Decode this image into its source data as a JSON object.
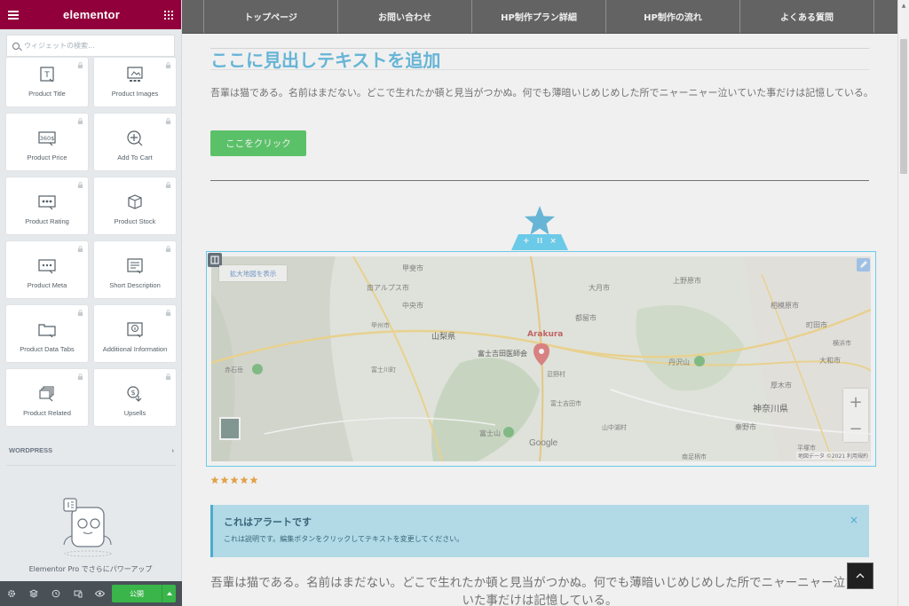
{
  "sidebar": {
    "brand": "elementor",
    "search_placeholder": "ウィジェットの検索...",
    "widgets": [
      {
        "label": "Product Title",
        "icon": "product-title-icon"
      },
      {
        "label": "Product Images",
        "icon": "product-images-icon"
      },
      {
        "label": "Product Price",
        "icon": "product-price-icon"
      },
      {
        "label": "Add To Cart",
        "icon": "add-to-cart-icon"
      },
      {
        "label": "Product Rating",
        "icon": "product-rating-icon"
      },
      {
        "label": "Product Stock",
        "icon": "product-stock-icon"
      },
      {
        "label": "Product Meta",
        "icon": "product-meta-icon"
      },
      {
        "label": "Short Description",
        "icon": "short-description-icon"
      },
      {
        "label": "Product Data Tabs",
        "icon": "product-data-tabs-icon"
      },
      {
        "label": "Additional Information",
        "icon": "additional-information-icon"
      },
      {
        "label": "Product Related",
        "icon": "product-related-icon"
      },
      {
        "label": "Upsells",
        "icon": "upsells-icon"
      }
    ],
    "price_icon_text": "360$",
    "wordpress_section": "WORDPRESS",
    "pro_upsell": "Elementor Pro でさらにパワーアップ",
    "publish_label": "公開"
  },
  "nav": {
    "items": [
      "トップページ",
      "お問い合わせ",
      "HP制作プラン詳細",
      "HP制作の流れ",
      "よくある質問"
    ]
  },
  "content": {
    "heading": "ここに見出しテキストを追加",
    "paragraph": "吾輩は猫である。名前はまだない。どこで生れたか頓と見当がつかぬ。何でも薄暗いじめじめした所でニャーニャー泣いていた事だけは記憶している。",
    "button": "ここをクリック",
    "map": {
      "larger_map": "拡大地図を表示",
      "zoom_in": "+",
      "zoom_out": "−",
      "google": "Google",
      "attribution": "地図データ ©2021   利用規約",
      "labels": {
        "arakura": "Arakura",
        "fujiyoshida": "富士吉田医師会",
        "yamanashi": "山梨県",
        "kanagawa": "神奈川県",
        "minami_alps": "南アルプス市",
        "kofu": "甲斐市",
        "chuo": "中央市",
        "otsuki": "大月市",
        "uenohara": "上野原市",
        "sagamihara": "相模原市",
        "machida": "町田市",
        "tsuru": "都留市",
        "tanzawa": "丹沢山",
        "atsugi": "厚木市",
        "yamato": "大和市",
        "hadano": "秦野市",
        "fujisan": "富士山",
        "minamiashigara": "南足柄市",
        "hiratsuka": "平塚市",
        "akaishi": "赤石岳",
        "fujikawa": "富士川町",
        "fujiyoshida_city": "富士吉田市",
        "yamanakako": "山中湖村",
        "oshino": "忍野村",
        "koshu": "甲州市",
        "yokohama": "横浜市"
      }
    },
    "rating": 5,
    "alert": {
      "title": "これはアラートです",
      "description": "これは説明です。編集ボタンをクリックしてテキストを変更してください。",
      "close": "×"
    },
    "paragraph2": "吾輩は猫である。名前はまだない。どこで生れたか頓と見当がつかぬ。何でも薄暗いじめじめした所でニャーニャー泣いていた事だけは記憶している。"
  },
  "colors": {
    "brand": "#92003b",
    "heading": "#6ec1e4",
    "button": "#61ce70",
    "publish": "#39b54a",
    "alert_bg": "#bde8f5",
    "selection": "#71d7f7"
  }
}
